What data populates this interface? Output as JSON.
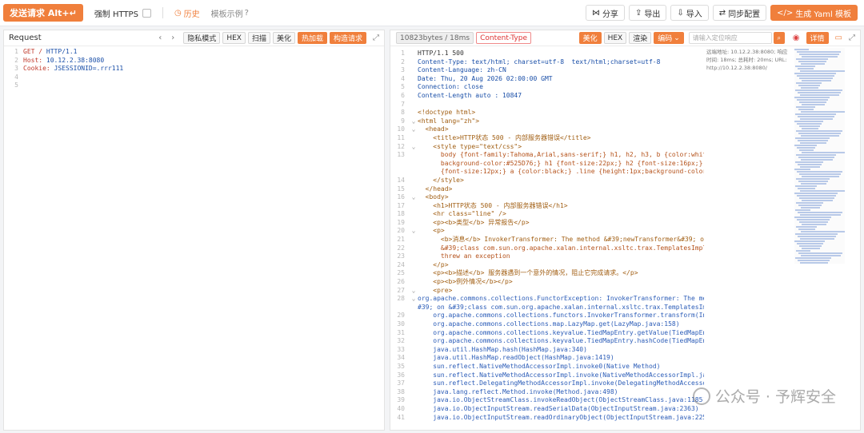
{
  "toolbar": {
    "send_label": "发送请求 Alt+↵",
    "force_https": "强制 HTTPS",
    "history": "历史",
    "examples": "模板示例",
    "share": "分享",
    "export": "导出",
    "import": "导入",
    "sync": "同步配置",
    "generate_yaml": "生成 Yaml 模板"
  },
  "request": {
    "title": "Request",
    "buttons": [
      "隐私模式",
      "HEX",
      "扫描",
      "美化",
      "热加载",
      "构造请求"
    ],
    "lines": [
      {
        "n": "1",
        "key": "GET /",
        "val": "HTTP/1.1"
      },
      {
        "n": "2",
        "key": "Host:",
        "val": "10.12.2.38:8080"
      },
      {
        "n": "3",
        "key": "Cookie:",
        "val": "JSESSIONID=.rrr111"
      },
      {
        "n": "4",
        "key": "",
        "val": ""
      },
      {
        "n": "5",
        "key": "",
        "val": ""
      }
    ]
  },
  "response": {
    "size_label": "10823bytes / 18ms",
    "content_type": "Content-Type",
    "buttons": [
      "美化",
      "HEX",
      "渲染",
      "编码"
    ],
    "search_placeholder": "请输入定位响应",
    "detail": "详情",
    "meta": [
      "远端地址: 10.12.2.38:8080; 响应",
      "时间: 18ms; 总耗时: 20ms; URL:",
      "http://10.12.2.38:8080/"
    ],
    "lines": [
      {
        "n": "1",
        "t": "HTTP/1.1 500"
      },
      {
        "n": "2",
        "t": "Content-Type: text/html; charset=utf-8  text/html;charset=utf-8"
      },
      {
        "n": "3",
        "t": "Content-Language: zh-CN"
      },
      {
        "n": "4",
        "t": "Date: Thu, 20 Aug 2026 02:00:00 GMT"
      },
      {
        "n": "5",
        "t": "Connection: close"
      },
      {
        "n": "6",
        "t": "Content-Length auto : 10847"
      },
      {
        "n": "7",
        "t": ""
      },
      {
        "n": "8",
        "t": "<!doctype html>"
      },
      {
        "n": "9",
        "t": "<html lang=\"zh\">"
      },
      {
        "n": "10",
        "t": "  <head>"
      },
      {
        "n": "11",
        "t": "    <title>HTTP状态 500 - 内部服务器错误</title>"
      },
      {
        "n": "12",
        "t": "    <style type=\"text/css\">"
      },
      {
        "n": "13",
        "t": "      body {font-family:Tahoma,Arial,sans-serif;} h1, h2, h3, b {color:white;"
      },
      {
        "n": "",
        "t": "      background-color:#525D76;} h1 {font-size:22px;} h2 {font-size:16px;} h3 {font-size:14px;} p"
      },
      {
        "n": "",
        "t": "      {font-size:12px;} a {color:black;} .line {height:1px;background-color:#525D76;border:none;}"
      },
      {
        "n": "14",
        "t": "    </style>"
      },
      {
        "n": "15",
        "t": "  </head>"
      },
      {
        "n": "16",
        "t": "  <body>"
      },
      {
        "n": "17",
        "t": "    <h1>HTTP状态 500 - 内部服务器错误</h1>"
      },
      {
        "n": "18",
        "t": "    <hr class=\"line\" />"
      },
      {
        "n": "19",
        "t": "    <p><b>类型</b> 异常报告</p>"
      },
      {
        "n": "20",
        "t": "    <p>"
      },
      {
        "n": "21",
        "t": "      <b>消息</b> InvokerTransformer: The method &#39;newTransformer&#39; on"
      },
      {
        "n": "22",
        "t": "      &#39;class com.sun.org.apache.xalan.internal.xsltc.trax.TemplatesImpl&#39;"
      },
      {
        "n": "23",
        "t": "      threw an exception"
      },
      {
        "n": "24",
        "t": "    </p>"
      },
      {
        "n": "25",
        "t": "    <p><b>描述</b> 服务器遇到一个意外的情况，阻止它完成请求。</p>"
      },
      {
        "n": "26",
        "t": "    <p><b>例外情况</b></p>"
      },
      {
        "n": "27",
        "t": "    <pre>"
      },
      {
        "n": "28",
        "t": "org.apache.commons.collections.FunctorException: InvokerTransformer: The method &#39;newTransformer&"
      },
      {
        "n": "",
        "t": "#39; on &#39;class com.sun.org.apache.xalan.internal.xsltc.trax.TemplatesImpl&#39; threw an exception"
      },
      {
        "n": "29",
        "t": "    org.apache.commons.collections.functors.InvokerTransformer.transform(InvokerTransformer.java:133)"
      },
      {
        "n": "30",
        "t": "    org.apache.commons.collections.map.LazyMap.get(LazyMap.java:158)"
      },
      {
        "n": "31",
        "t": "    org.apache.commons.collections.keyvalue.TiedMapEntry.getValue(TiedMapEntry.java:74)"
      },
      {
        "n": "32",
        "t": "    org.apache.commons.collections.keyvalue.TiedMapEntry.hashCode(TiedMapEntry.java:121)"
      },
      {
        "n": "33",
        "t": "    java.util.HashMap.hash(HashMap.java:340)"
      },
      {
        "n": "34",
        "t": "    java.util.HashMap.readObject(HashMap.java:1419)"
      },
      {
        "n": "35",
        "t": "    sun.reflect.NativeMethodAccessorImpl.invoke0(Native Method)"
      },
      {
        "n": "36",
        "t": "    sun.reflect.NativeMethodAccessorImpl.invoke(NativeMethodAccessorImpl.java:62)"
      },
      {
        "n": "37",
        "t": "    sun.reflect.DelegatingMethodAccessorImpl.invoke(DelegatingMethodAccessorImpl.java:43)"
      },
      {
        "n": "38",
        "t": "    java.lang.reflect.Method.invoke(Method.java:498)"
      },
      {
        "n": "39",
        "t": "    java.io.ObjectStreamClass.invokeReadObject(ObjectStreamClass.java:1185)"
      },
      {
        "n": "40",
        "t": "    java.io.ObjectInputStream.readSerialData(ObjectInputStream.java:2363)"
      },
      {
        "n": "41",
        "t": "    java.io.ObjectInputStream.readOrdinaryObject(ObjectInputStream.java:2254)"
      }
    ]
  },
  "watermark": "公众号 · 予辉安全",
  "colors": {
    "accent": "#f07f3c"
  }
}
